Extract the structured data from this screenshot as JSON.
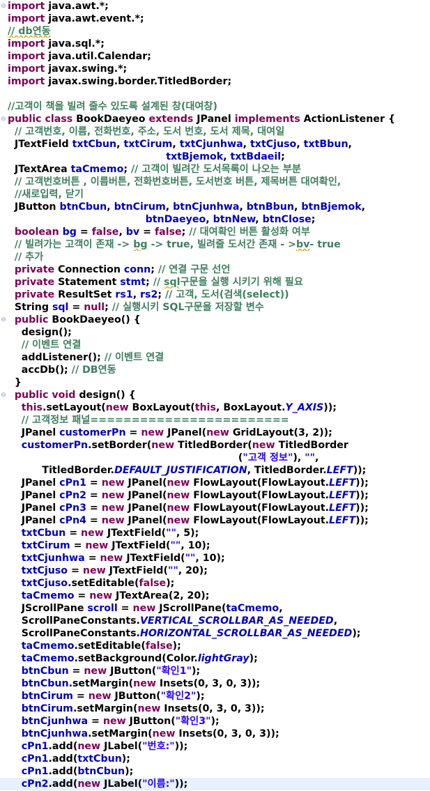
{
  "editor": {
    "language": "java",
    "current_line_index": 62,
    "colors": {
      "keyword": "#7f0055",
      "comment": "#3f7f5f",
      "field": "#0000c0",
      "constant": "#0000c0",
      "string": "#2a00ff",
      "plain": "#000000",
      "current_line_bg": "#e8f2fe",
      "fold_marker": "#7f9fbf"
    },
    "fold_markers": [
      {
        "line": 0,
        "symbol": "⊖"
      },
      {
        "line": 9,
        "symbol": "⊖"
      },
      {
        "line": 25,
        "symbol": "⊖"
      },
      {
        "line": 31,
        "symbol": "⊖"
      }
    ],
    "lines": [
      [
        [
          "kw",
          "import"
        ],
        [
          "pl",
          " java.awt.*;"
        ]
      ],
      [
        [
          "kw",
          "import"
        ],
        [
          "pl",
          " java.awt.event.*;"
        ]
      ],
      [
        [
          "cm",
          "// db연동",
          "squig"
        ]
      ],
      [
        [
          "kw",
          "import"
        ],
        [
          "pl",
          " java.sql.*;"
        ]
      ],
      [
        [
          "kw",
          "import"
        ],
        [
          "pl",
          " java.util.Calendar;"
        ]
      ],
      [
        [
          "kw",
          "import"
        ],
        [
          "pl",
          " javax.swing.*;"
        ]
      ],
      [
        [
          "kw",
          "import"
        ],
        [
          "pl",
          " javax.swing.border.TitledBorder;"
        ]
      ],
      [],
      [
        [
          "cm",
          "//고객이 책을 빌려 줄수 있도록 설계된 창(대여창)"
        ]
      ],
      [
        [
          "kw",
          "public class"
        ],
        [
          "pl",
          " BookDaeyeo "
        ],
        [
          "kw",
          "extends"
        ],
        [
          "pl",
          " JPanel "
        ],
        [
          "kw",
          "implements"
        ],
        [
          "pl",
          " ActionListener {"
        ]
      ],
      [
        [
          "cm",
          "  // 고객번호, 이름, 전화번호, 주소, 도서 번호, 도서 제목, 대여일"
        ]
      ],
      [
        [
          "pl",
          "  JTextField "
        ],
        [
          "fld",
          "txtCbun"
        ],
        [
          "pl",
          ", "
        ],
        [
          "fld",
          "txtCirum"
        ],
        [
          "pl",
          ", "
        ],
        [
          "fld",
          "txtCjunhwa"
        ],
        [
          "pl",
          ", "
        ],
        [
          "fld",
          "txtCjuso"
        ],
        [
          "pl",
          ", "
        ],
        [
          "fld",
          "txtBbun"
        ],
        [
          "pl",
          ","
        ]
      ],
      [
        [
          "pl",
          "                                              "
        ],
        [
          "fld",
          "txtBjemok"
        ],
        [
          "pl",
          ", "
        ],
        [
          "fld",
          "txtBdaeil"
        ],
        [
          "pl",
          ";"
        ]
      ],
      [
        [
          "pl",
          "  JTextArea "
        ],
        [
          "fld",
          "taCmemo"
        ],
        [
          "pl",
          "; "
        ],
        [
          "cm",
          "// 고객이 빌려간 도서목록이 나오는 부분"
        ]
      ],
      [
        [
          "cm",
          "  // 고객번호버튼 , 이름버튼, 전화번호버튼, 도서번호 버튼, 제목버튼 대여확인,"
        ]
      ],
      [
        [
          "cm",
          "  //새로입력, 닫기"
        ]
      ],
      [
        [
          "pl",
          "  JButton "
        ],
        [
          "fld",
          "btnCbun"
        ],
        [
          "pl",
          ", "
        ],
        [
          "fld",
          "btnCirum"
        ],
        [
          "pl",
          ", "
        ],
        [
          "fld",
          "btnCjunhwa"
        ],
        [
          "pl",
          ", "
        ],
        [
          "fld",
          "btnBbun"
        ],
        [
          "pl",
          ", "
        ],
        [
          "fld",
          "btnBjemok"
        ],
        [
          "pl",
          ","
        ]
      ],
      [
        [
          "pl",
          "                                        "
        ],
        [
          "fld",
          "btnDaeyeo"
        ],
        [
          "pl",
          ", "
        ],
        [
          "fld",
          "btnNew"
        ],
        [
          "pl",
          ", "
        ],
        [
          "fld",
          "btnClose"
        ],
        [
          "pl",
          ";"
        ]
      ],
      [
        [
          "kw",
          "  boolean"
        ],
        [
          "pl",
          " "
        ],
        [
          "fld",
          "bg"
        ],
        [
          "pl",
          " = "
        ],
        [
          "kw",
          "false"
        ],
        [
          "pl",
          ", "
        ],
        [
          "fld",
          "bv"
        ],
        [
          "pl",
          " = "
        ],
        [
          "kw",
          "false"
        ],
        [
          "pl",
          "; "
        ],
        [
          "cm",
          "// 대여확인 버튼 활성화 여부"
        ]
      ],
      [
        [
          "cm",
          "  // 빌려가는 고객이 존재 -> "
        ],
        [
          "cm",
          "bg",
          "squig"
        ],
        [
          "cm",
          " -> true, 빌려줄 도서간 존재 - >"
        ],
        [
          "cm",
          "bv",
          "squig"
        ],
        [
          "cm",
          "- true"
        ]
      ],
      [
        [
          "cm",
          "  // 추가"
        ]
      ],
      [
        [
          "kw",
          "  private"
        ],
        [
          "pl",
          " Connection "
        ],
        [
          "fld",
          "conn"
        ],
        [
          "pl",
          "; "
        ],
        [
          "cm",
          "// 연결 구문 선언"
        ]
      ],
      [
        [
          "kw",
          "  private"
        ],
        [
          "pl",
          " Statement "
        ],
        [
          "fld",
          "stmt"
        ],
        [
          "pl",
          "; "
        ],
        [
          "cm",
          "// "
        ],
        [
          "cm",
          "sql",
          "squig"
        ],
        [
          "cm",
          "구문을 실행 시키기 위해 필요"
        ]
      ],
      [
        [
          "kw",
          "  private"
        ],
        [
          "pl",
          " ResultSet "
        ],
        [
          "fld",
          "rs1"
        ],
        [
          "pl",
          ", "
        ],
        [
          "fld",
          "rs2"
        ],
        [
          "pl",
          "; "
        ],
        [
          "cm",
          "// 고객, 도서(검색(select))"
        ]
      ],
      [
        [
          "pl",
          "  String "
        ],
        [
          "fld",
          "sql"
        ],
        [
          "pl",
          " = "
        ],
        [
          "kw",
          "null"
        ],
        [
          "pl",
          "; "
        ],
        [
          "cm",
          "// 실행시키 SQL구문을 저장할 변수"
        ]
      ],
      [
        [
          "kw",
          "  public"
        ],
        [
          "pl",
          " BookDaeyeo() {"
        ]
      ],
      [
        [
          "pl",
          "    design();"
        ]
      ],
      [
        [
          "cm",
          "    // 이벤트 연결"
        ]
      ],
      [
        [
          "pl",
          "    addListener(); "
        ],
        [
          "cm",
          "// 이벤트 연결"
        ]
      ],
      [
        [
          "pl",
          "    accDb(); "
        ],
        [
          "cm",
          "// DB연동"
        ]
      ],
      [
        [
          "pl",
          "  }"
        ]
      ],
      [
        [
          "kw",
          "  public void"
        ],
        [
          "pl",
          " design() {"
        ]
      ],
      [
        [
          "kw",
          "    this"
        ],
        [
          "pl",
          ".setLayout("
        ],
        [
          "kw",
          "new"
        ],
        [
          "pl",
          " BoxLayout("
        ],
        [
          "kw",
          "this"
        ],
        [
          "pl",
          ", BoxLayout."
        ],
        [
          "const",
          "Y_AXIS"
        ],
        [
          "pl",
          "));"
        ]
      ],
      [
        [
          "cm",
          "    // 고객정보 패널========================"
        ]
      ],
      [
        [
          "pl",
          "    JPanel "
        ],
        [
          "fld",
          "customerPn"
        ],
        [
          "pl",
          " = "
        ],
        [
          "kw",
          "new"
        ],
        [
          "pl",
          " JPanel("
        ],
        [
          "kw",
          "new"
        ],
        [
          "pl",
          " GridLayout(3, 2));"
        ]
      ],
      [
        [
          "pl",
          "    "
        ],
        [
          "fld",
          "customerPn"
        ],
        [
          "pl",
          ".setBorder("
        ],
        [
          "kw",
          "new"
        ],
        [
          "pl",
          " TitledBorder("
        ],
        [
          "kw",
          "new"
        ],
        [
          "pl",
          " TitledBorder"
        ]
      ],
      [
        [
          "pl",
          "                                                                   ("
        ],
        [
          "str",
          "\"고객 정보\""
        ],
        [
          "pl",
          "), "
        ],
        [
          "str",
          "\"\""
        ],
        [
          "pl",
          ","
        ]
      ],
      [
        [
          "pl",
          "          TitledBorder."
        ],
        [
          "const",
          "DEFAULT_JUSTIFICATION"
        ],
        [
          "pl",
          ", TitledBorder."
        ],
        [
          "const",
          "LEFT"
        ],
        [
          "pl",
          "));"
        ]
      ],
      [
        [
          "pl",
          "    JPanel "
        ],
        [
          "fld",
          "cPn1"
        ],
        [
          "pl",
          " = "
        ],
        [
          "kw",
          "new"
        ],
        [
          "pl",
          " JPanel("
        ],
        [
          "kw",
          "new"
        ],
        [
          "pl",
          " FlowLayout(FlowLayout."
        ],
        [
          "const",
          "LEFT"
        ],
        [
          "pl",
          "));"
        ]
      ],
      [
        [
          "pl",
          "    JPanel "
        ],
        [
          "fld",
          "cPn2"
        ],
        [
          "pl",
          " = "
        ],
        [
          "kw",
          "new"
        ],
        [
          "pl",
          " JPanel("
        ],
        [
          "kw",
          "new"
        ],
        [
          "pl",
          " FlowLayout(FlowLayout."
        ],
        [
          "const",
          "LEFT"
        ],
        [
          "pl",
          "));"
        ]
      ],
      [
        [
          "pl",
          "    JPanel "
        ],
        [
          "fld",
          "cPn3"
        ],
        [
          "pl",
          " = "
        ],
        [
          "kw",
          "new"
        ],
        [
          "pl",
          " JPanel("
        ],
        [
          "kw",
          "new"
        ],
        [
          "pl",
          " FlowLayout(FlowLayout."
        ],
        [
          "const",
          "LEFT"
        ],
        [
          "pl",
          "));"
        ]
      ],
      [
        [
          "pl",
          "    JPanel "
        ],
        [
          "fld",
          "cPn4"
        ],
        [
          "pl",
          " = "
        ],
        [
          "kw",
          "new"
        ],
        [
          "pl",
          " JPanel("
        ],
        [
          "kw",
          "new"
        ],
        [
          "pl",
          " FlowLayout(FlowLayout."
        ],
        [
          "const",
          "LEFT"
        ],
        [
          "pl",
          "));"
        ]
      ],
      [
        [
          "pl",
          "    "
        ],
        [
          "fld",
          "txtCbun"
        ],
        [
          "pl",
          " = "
        ],
        [
          "kw",
          "new"
        ],
        [
          "pl",
          " JTextField("
        ],
        [
          "str",
          "\"\""
        ],
        [
          "pl",
          ", 5);"
        ]
      ],
      [
        [
          "pl",
          "    "
        ],
        [
          "fld",
          "txtCirum"
        ],
        [
          "pl",
          " = "
        ],
        [
          "kw",
          "new"
        ],
        [
          "pl",
          " JTextField("
        ],
        [
          "str",
          "\"\""
        ],
        [
          "pl",
          ", 10);"
        ]
      ],
      [
        [
          "pl",
          "    "
        ],
        [
          "fld",
          "txtCjunhwa"
        ],
        [
          "pl",
          " = "
        ],
        [
          "kw",
          "new"
        ],
        [
          "pl",
          " JTextField("
        ],
        [
          "str",
          "\"\""
        ],
        [
          "pl",
          ", 10);"
        ]
      ],
      [
        [
          "pl",
          "    "
        ],
        [
          "fld",
          "txtCjuso"
        ],
        [
          "pl",
          " = "
        ],
        [
          "kw",
          "new"
        ],
        [
          "pl",
          " JTextField("
        ],
        [
          "str",
          "\"\""
        ],
        [
          "pl",
          ", 20);"
        ]
      ],
      [
        [
          "pl",
          "    "
        ],
        [
          "fld",
          "txtCjuso"
        ],
        [
          "pl",
          ".setEditable("
        ],
        [
          "kw",
          "false"
        ],
        [
          "pl",
          ");"
        ]
      ],
      [
        [
          "pl",
          "    "
        ],
        [
          "fld",
          "taCmemo"
        ],
        [
          "pl",
          " = "
        ],
        [
          "kw",
          "new"
        ],
        [
          "pl",
          " JTextArea(2, 20);"
        ]
      ],
      [
        [
          "pl",
          "    JScrollPane "
        ],
        [
          "fld",
          "scroll"
        ],
        [
          "pl",
          " = "
        ],
        [
          "kw",
          "new"
        ],
        [
          "pl",
          " JScrollPane("
        ],
        [
          "fld",
          "taCmemo"
        ],
        [
          "pl",
          ","
        ]
      ],
      [
        [
          "pl",
          "    ScrollPaneConstants."
        ],
        [
          "const",
          "VERTICAL_SCROLLBAR_AS_NEEDED"
        ],
        [
          "pl",
          ","
        ]
      ],
      [
        [
          "pl",
          "    ScrollPaneConstants."
        ],
        [
          "const",
          "HORIZONTAL_SCROLLBAR_AS_NEEDED"
        ],
        [
          "pl",
          ");"
        ]
      ],
      [
        [
          "pl",
          "    "
        ],
        [
          "fld",
          "taCmemo"
        ],
        [
          "pl",
          ".setEditable("
        ],
        [
          "kw",
          "false"
        ],
        [
          "pl",
          ");"
        ]
      ],
      [
        [
          "pl",
          "    "
        ],
        [
          "fld",
          "taCmemo"
        ],
        [
          "pl",
          ".setBackground(Color."
        ],
        [
          "const",
          "lightGray"
        ],
        [
          "pl",
          ");"
        ]
      ],
      [
        [
          "pl",
          "    "
        ],
        [
          "fld",
          "btnCbun"
        ],
        [
          "pl",
          " = "
        ],
        [
          "kw",
          "new"
        ],
        [
          "pl",
          " JButton("
        ],
        [
          "str",
          "\"확인1\""
        ],
        [
          "pl",
          ");"
        ]
      ],
      [
        [
          "pl",
          "    "
        ],
        [
          "fld",
          "btnCbun"
        ],
        [
          "pl",
          ".setMargin("
        ],
        [
          "kw",
          "new"
        ],
        [
          "pl",
          " Insets(0, 3, 0, 3));"
        ]
      ],
      [
        [
          "pl",
          "    "
        ],
        [
          "fld",
          "btnCirum"
        ],
        [
          "pl",
          " = "
        ],
        [
          "kw",
          "new"
        ],
        [
          "pl",
          " JButton("
        ],
        [
          "str",
          "\"확인2\""
        ],
        [
          "pl",
          ");"
        ]
      ],
      [
        [
          "pl",
          "    "
        ],
        [
          "fld",
          "btnCirum"
        ],
        [
          "pl",
          ".setMargin("
        ],
        [
          "kw",
          "new"
        ],
        [
          "pl",
          " Insets(0, 3, 0, 3));"
        ]
      ],
      [
        [
          "pl",
          "    "
        ],
        [
          "fld",
          "btnCjunhwa"
        ],
        [
          "pl",
          " = "
        ],
        [
          "kw",
          "new"
        ],
        [
          "pl",
          " JButton("
        ],
        [
          "str",
          "\"확인3\""
        ],
        [
          "pl",
          ");"
        ]
      ],
      [
        [
          "pl",
          "    "
        ],
        [
          "fld",
          "btnCjunhwa"
        ],
        [
          "pl",
          ".setMargin("
        ],
        [
          "kw",
          "new"
        ],
        [
          "pl",
          " Insets(0, 3, 0, 3));"
        ]
      ],
      [
        [
          "pl",
          "    "
        ],
        [
          "fld",
          "cPn1"
        ],
        [
          "pl",
          ".add("
        ],
        [
          "kw",
          "new"
        ],
        [
          "pl",
          " JLabel("
        ],
        [
          "str",
          "\"번호:\""
        ],
        [
          "pl",
          "));"
        ]
      ],
      [
        [
          "pl",
          "    "
        ],
        [
          "fld",
          "cPn1"
        ],
        [
          "pl",
          ".add("
        ],
        [
          "fld",
          "txtCbun"
        ],
        [
          "pl",
          ");"
        ]
      ],
      [
        [
          "pl",
          "    "
        ],
        [
          "fld",
          "cPn1"
        ],
        [
          "pl",
          ".add("
        ],
        [
          "fld",
          "btnCbun"
        ],
        [
          "pl",
          ");"
        ]
      ],
      [
        [
          "pl",
          "    "
        ],
        [
          "fld",
          "cPn2"
        ],
        [
          "pl",
          ".add("
        ],
        [
          "kw",
          "new"
        ],
        [
          "pl",
          " JLabel("
        ],
        [
          "str",
          "\"이름:\""
        ],
        [
          "pl",
          "));"
        ]
      ]
    ]
  }
}
